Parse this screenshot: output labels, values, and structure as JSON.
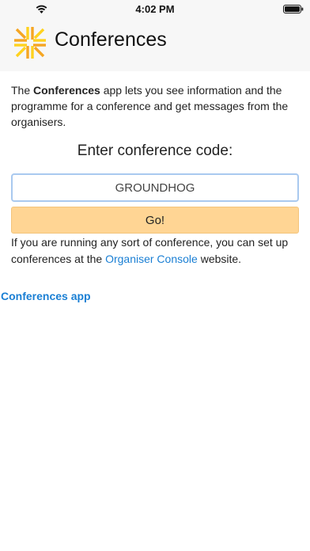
{
  "status_bar": {
    "time": "4:02 PM",
    "wifi_icon": "wifi-icon",
    "battery_icon": "battery-icon"
  },
  "header": {
    "logo_icon": "conferences-logo-icon",
    "title": "Conferences"
  },
  "intro": {
    "prefix": "The ",
    "app_name": "Conferences",
    "suffix": " app lets you see information and the programme for a conference and get messages from the organisers."
  },
  "form": {
    "label": "Enter conference code:",
    "code_value": "GROUNDHOG",
    "go_label": "Go!"
  },
  "organiser": {
    "prefix": "If you are running any sort of conference, you can set up conferences at the ",
    "link_text": "Organiser Console",
    "suffix": " website."
  },
  "footer": {
    "link_text": "Conferences app"
  },
  "colors": {
    "link": "#1a7fd4",
    "button_bg": "#ffd594",
    "input_border": "#a9c9ef",
    "header_bg": "#f7f7f7",
    "logo_orange": "#f5a623",
    "logo_yellow": "#ffd21f"
  }
}
